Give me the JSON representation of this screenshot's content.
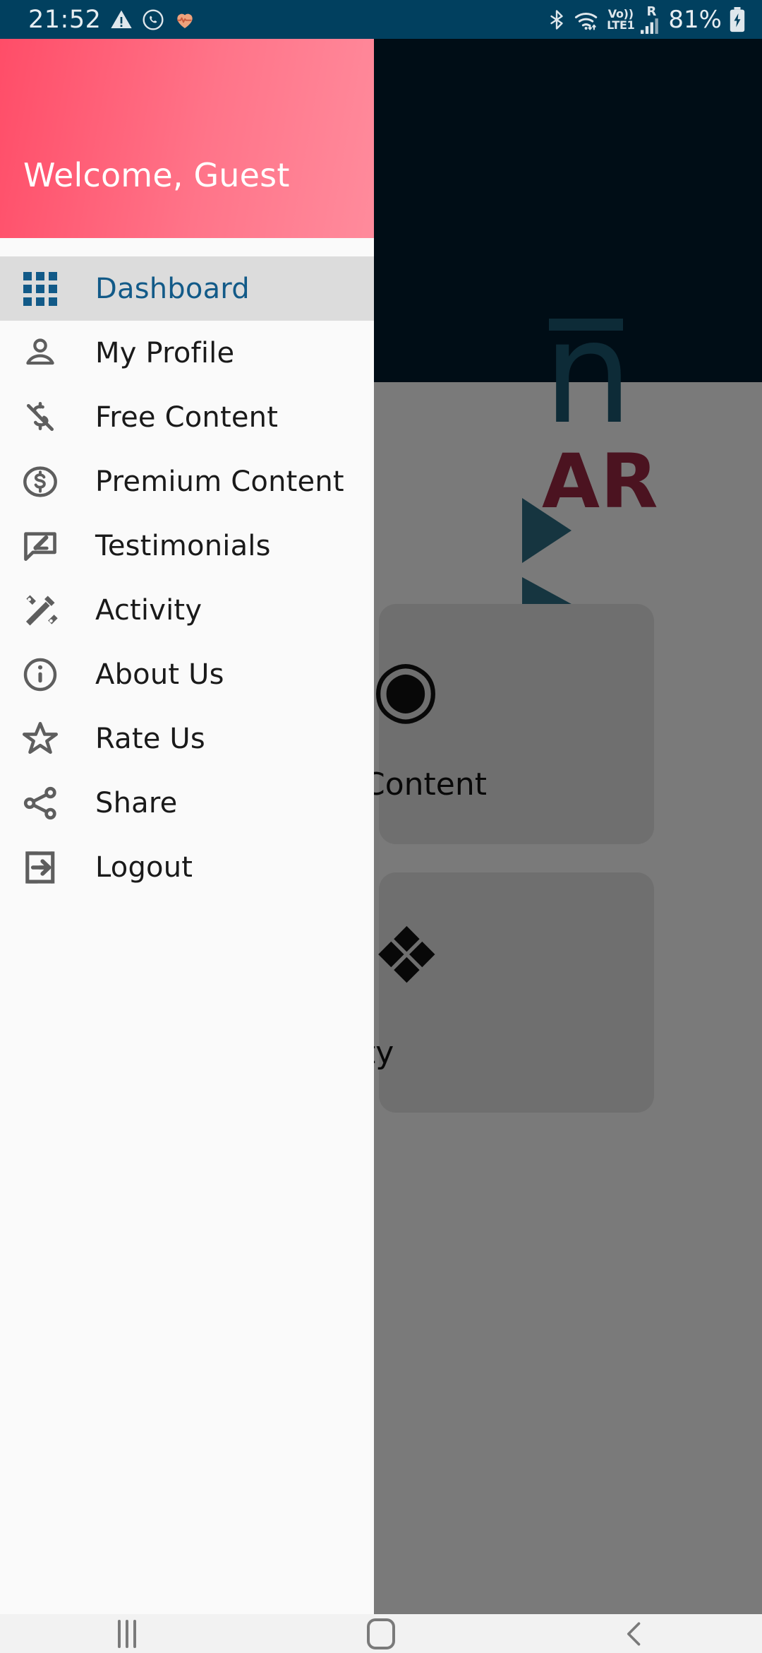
{
  "status_bar": {
    "time": "21:52",
    "battery_percent": "81%",
    "left_icons": [
      "warning-triangle-icon",
      "whatsapp-icon",
      "heart-pulse-icon"
    ],
    "right_icons": [
      "bluetooth-icon",
      "wifi-icon",
      "volte-icon",
      "signal-bars-icon",
      "battery-charging-icon"
    ],
    "network_label_top": "Vo))",
    "network_label_bottom": "LTE1",
    "roaming_label": "R"
  },
  "drawer": {
    "header": {
      "welcome_text": "Welcome, Guest",
      "gradient_start": "#ff4d68",
      "gradient_end": "#ff8b9c"
    },
    "active_item_color": "#125a88",
    "active_item_background": "#dcdcdc",
    "items": [
      {
        "label": "Dashboard",
        "icon": "grid-icon",
        "active": true
      },
      {
        "label": "My Profile",
        "icon": "person-icon",
        "active": false
      },
      {
        "label": "Free Content",
        "icon": "money-off-icon",
        "active": false
      },
      {
        "label": "Premium Content",
        "icon": "dollar-circle-icon",
        "active": false
      },
      {
        "label": "Testimonials",
        "icon": "rate-review-icon",
        "active": false
      },
      {
        "label": "Activity",
        "icon": "design-services-icon",
        "active": false
      },
      {
        "label": "About Us",
        "icon": "info-circle-icon",
        "active": false
      },
      {
        "label": "Rate Us",
        "icon": "star-outline-icon",
        "active": false
      },
      {
        "label": "Share",
        "icon": "share-nodes-icon",
        "active": false
      },
      {
        "label": "Logout",
        "icon": "logout-icon",
        "active": false
      }
    ]
  },
  "background_app": {
    "logo_letter": "n",
    "logo_text": "AR",
    "logo_color": "#1d5a73",
    "logo_text_color": "#9e2843",
    "appbar_color": "#011c2e",
    "cards": [
      {
        "label": "Content",
        "icon": "dollar-circle-icon"
      },
      {
        "label": "ty",
        "icon": "design-services-icon"
      }
    ]
  },
  "nav_bar": {
    "buttons": [
      {
        "name": "recent-apps-button",
        "icon": "recent-apps-icon"
      },
      {
        "name": "home-button",
        "icon": "home-icon"
      },
      {
        "name": "back-button",
        "icon": "back-chevron-icon"
      }
    ]
  }
}
